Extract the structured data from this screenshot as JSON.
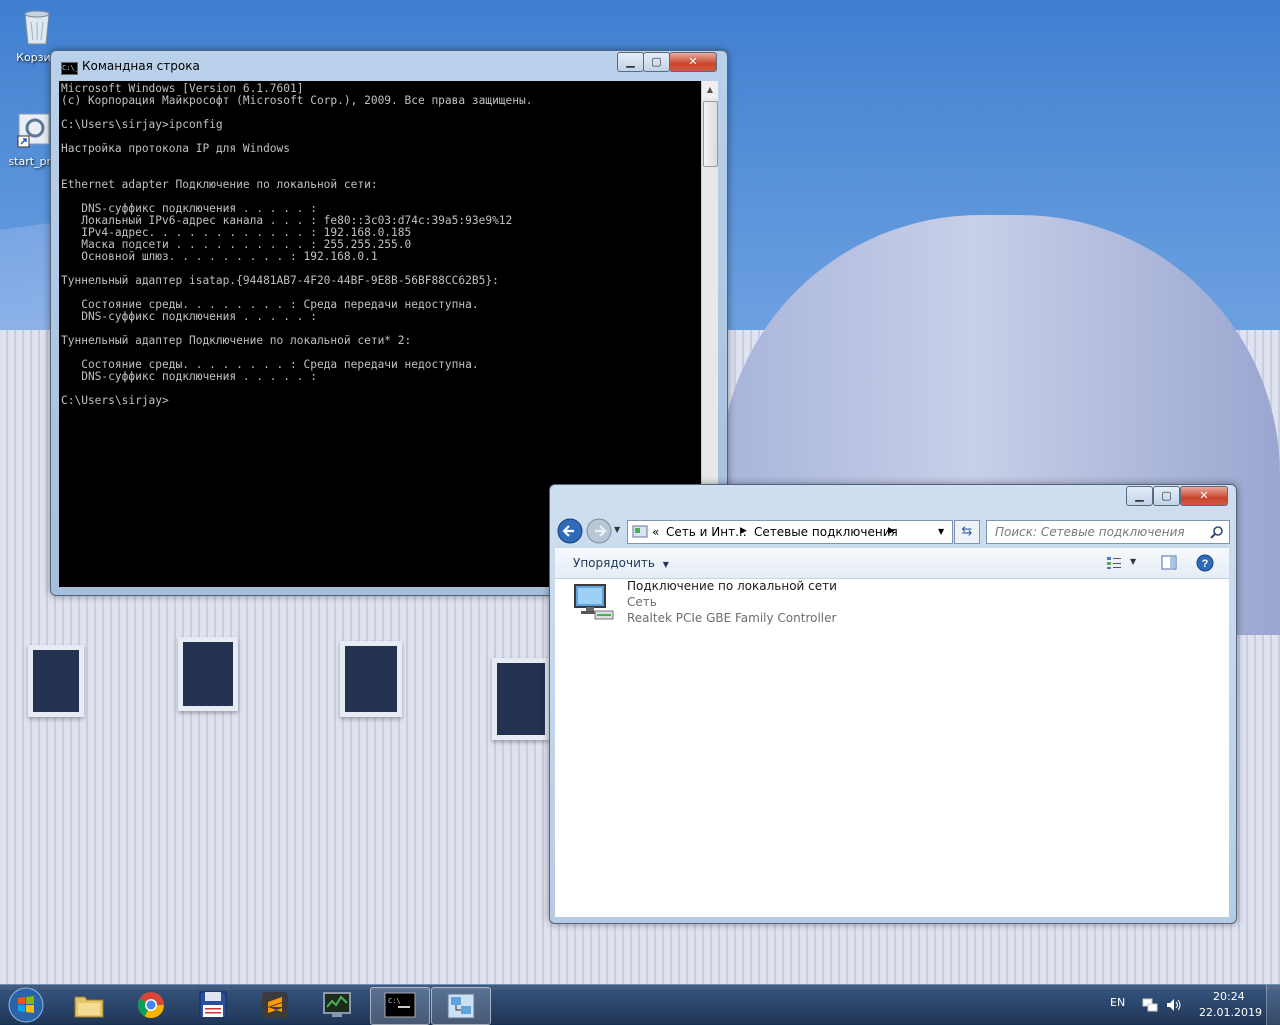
{
  "desktop": {
    "icons": [
      {
        "label": "Корзин"
      },
      {
        "label": "start_pro"
      }
    ]
  },
  "cmd_window": {
    "title": "Командная строка",
    "icon_text": "C:\\_",
    "controls": {
      "minimize": "▁",
      "maximize": "▢",
      "close": "✕"
    },
    "console_lines": [
      "Microsoft Windows [Version 6.1.7601]",
      "(c) Корпорация Майкрософт (Microsoft Corp.), 2009. Все права защищены.",
      "",
      "C:\\Users\\sirjay>ipconfig",
      "",
      "Настройка протокола IP для Windows",
      "",
      "",
      "Ethernet adapter Подключение по локальной сети:",
      "",
      "   DNS-суффикс подключения . . . . . :",
      "   Локальный IPv6-адрес канала . . . : fe80::3c03:d74c:39a5:93e9%12",
      "   IPv4-адрес. . . . . . . . . . . . : 192.168.0.185",
      "   Маска подсети . . . . . . . . . . : 255.255.255.0",
      "   Основной шлюз. . . . . . . . . : 192.168.0.1",
      "",
      "Туннельный адаптер isatap.{94481AB7-4F20-44BF-9E8B-56BF88CC62B5}:",
      "",
      "   Состояние среды. . . . . . . . : Среда передачи недоступна.",
      "   DNS-суффикс подключения . . . . . :",
      "",
      "Туннельный адаптер Подключение по локальной сети* 2:",
      "",
      "   Состояние среды. . . . . . . . : Среда передачи недоступна.",
      "   DNS-суффикс подключения . . . . . :",
      "",
      "C:\\Users\\sirjay>"
    ]
  },
  "explorer_window": {
    "controls": {
      "minimize": "▁",
      "maximize": "▢",
      "close": "✕"
    },
    "breadcrumb": {
      "overflow": "«",
      "segment1": "Сеть и Инт...",
      "segment2": "Сетевые подключения"
    },
    "search_placeholder": "Поиск: Сетевые подключения",
    "toolbar": {
      "organize_label": "Упорядочить"
    },
    "connection": {
      "name": "Подключение по локальной сети",
      "network": "Сеть",
      "adapter": "Realtek PCIe GBE Family Controller"
    }
  },
  "taskbar": {
    "language": "EN",
    "time": "20:24",
    "date": "22.01.2019",
    "apps": [
      "explorer",
      "chrome",
      "floppy-app",
      "sublime-text",
      "task-manager",
      "command-prompt",
      "network-connections"
    ]
  },
  "colors": {
    "console_bg": "#000000",
    "console_fg": "#c0c0c0",
    "taskbar": "#1c3556",
    "close_button": "#c9452d"
  }
}
